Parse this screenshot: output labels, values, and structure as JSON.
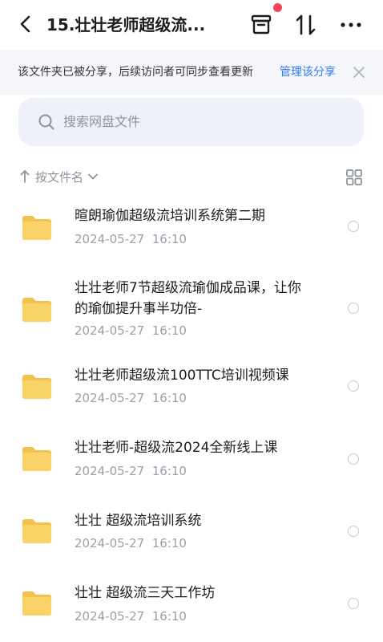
{
  "header": {
    "title": "15.壮壮老师超级流..."
  },
  "notice": {
    "text": "该文件夹已被分享，后续访问者可同步查看更新",
    "link": "管理该分享"
  },
  "search": {
    "placeholder": "搜索网盘文件"
  },
  "sort": {
    "label": "按文件名"
  },
  "accent_color": "#2f7bf6",
  "badge_color": "#f0435a",
  "folder_color": "#f9d367",
  "files": [
    {
      "line1": "暄朗瑜伽超级流培训系统第二期",
      "line2": "",
      "date": "2024-05-27",
      "time": "16:10"
    },
    {
      "line1": "壮壮老师7节超级流瑜伽成品课，让你",
      "line2": "的瑜伽提升事半功倍-",
      "date": "2024-05-27",
      "time": "16:10"
    },
    {
      "line1": "壮壮老师超级流100TTC培训视频课",
      "line2": "",
      "date": "2024-05-27",
      "time": "16:10"
    },
    {
      "line1": "壮壮老师-超级流2024全新线上课",
      "line2": "",
      "date": "2024-05-27",
      "time": "16:10"
    },
    {
      "line1": "壮壮 超级流培训系统",
      "line2": "",
      "date": "2024-05-27",
      "time": "16:10"
    },
    {
      "line1": "壮壮 超级流三天工作坊",
      "line2": "",
      "date": "2024-05-27",
      "time": "16:10"
    }
  ]
}
